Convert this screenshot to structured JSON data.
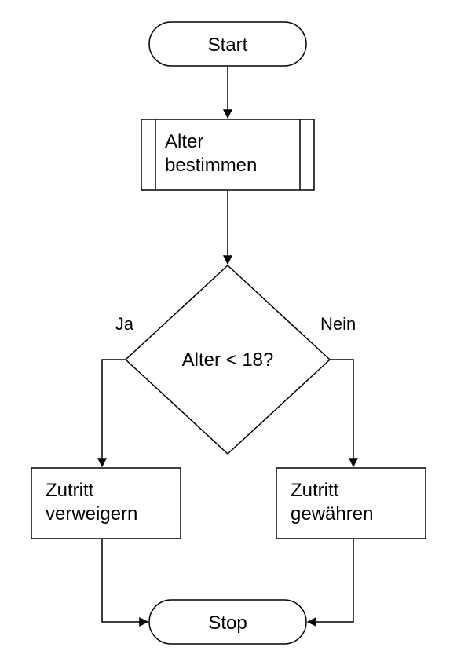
{
  "flow": {
    "start": "Start",
    "process": {
      "line1": "Alter",
      "line2": "bestimmen"
    },
    "decision": "Alter < 18?",
    "decision_yes": "Ja",
    "decision_no": "Nein",
    "branch_yes": {
      "line1": "Zutritt",
      "line2": "verweigern"
    },
    "branch_no": {
      "line1": "Zutritt",
      "line2": "gewähren"
    },
    "stop": "Stop"
  }
}
